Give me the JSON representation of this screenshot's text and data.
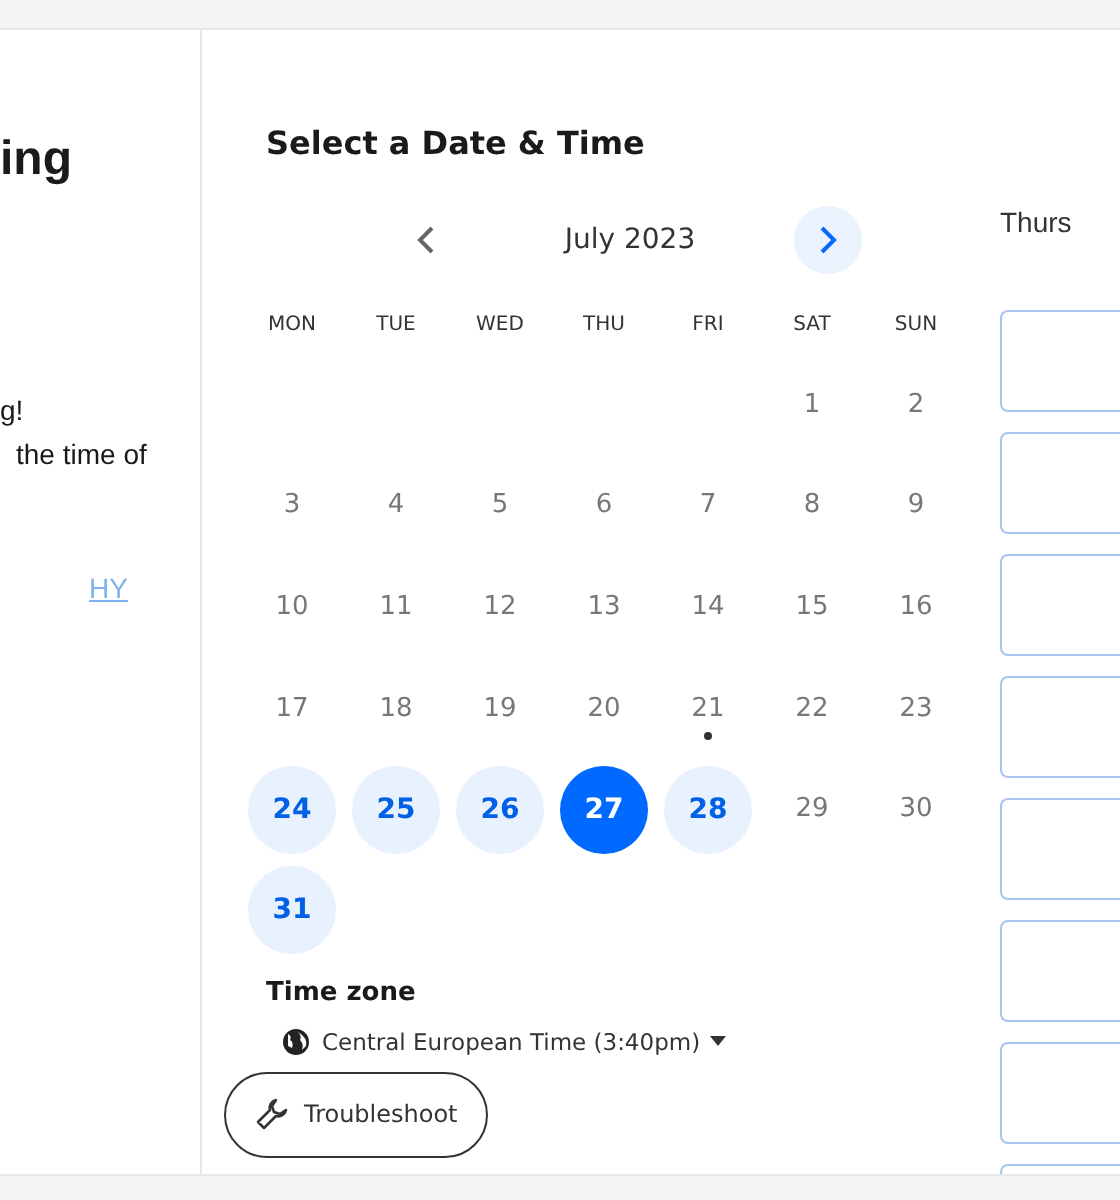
{
  "intro": {
    "title_fragment": "ing",
    "description_lines": [
      "g!",
      "the time of"
    ],
    "link": "HY"
  },
  "calendar": {
    "title": "Select a Date & Time",
    "month": "July 2023",
    "weekdays": [
      "MON",
      "TUE",
      "WED",
      "THU",
      "FRI",
      "SAT",
      "SUN"
    ],
    "days": [
      {
        "kind": "blank"
      },
      {
        "kind": "blank"
      },
      {
        "kind": "blank"
      },
      {
        "kind": "blank"
      },
      {
        "kind": "blank"
      },
      {
        "kind": "day",
        "label": "1",
        "available": false,
        "selected": false,
        "today": false
      },
      {
        "kind": "day",
        "label": "2",
        "available": false,
        "selected": false,
        "today": false
      },
      {
        "kind": "day",
        "label": "3",
        "available": false,
        "selected": false,
        "today": false
      },
      {
        "kind": "day",
        "label": "4",
        "available": false,
        "selected": false,
        "today": false
      },
      {
        "kind": "day",
        "label": "5",
        "available": false,
        "selected": false,
        "today": false
      },
      {
        "kind": "day",
        "label": "6",
        "available": false,
        "selected": false,
        "today": false
      },
      {
        "kind": "day",
        "label": "7",
        "available": false,
        "selected": false,
        "today": false
      },
      {
        "kind": "day",
        "label": "8",
        "available": false,
        "selected": false,
        "today": false
      },
      {
        "kind": "day",
        "label": "9",
        "available": false,
        "selected": false,
        "today": false
      },
      {
        "kind": "day",
        "label": "10",
        "available": false,
        "selected": false,
        "today": false
      },
      {
        "kind": "day",
        "label": "11",
        "available": false,
        "selected": false,
        "today": false
      },
      {
        "kind": "day",
        "label": "12",
        "available": false,
        "selected": false,
        "today": false
      },
      {
        "kind": "day",
        "label": "13",
        "available": false,
        "selected": false,
        "today": false
      },
      {
        "kind": "day",
        "label": "14",
        "available": false,
        "selected": false,
        "today": false
      },
      {
        "kind": "day",
        "label": "15",
        "available": false,
        "selected": false,
        "today": false
      },
      {
        "kind": "day",
        "label": "16",
        "available": false,
        "selected": false,
        "today": false
      },
      {
        "kind": "day",
        "label": "17",
        "available": false,
        "selected": false,
        "today": false
      },
      {
        "kind": "day",
        "label": "18",
        "available": false,
        "selected": false,
        "today": false
      },
      {
        "kind": "day",
        "label": "19",
        "available": false,
        "selected": false,
        "today": false
      },
      {
        "kind": "day",
        "label": "20",
        "available": false,
        "selected": false,
        "today": false
      },
      {
        "kind": "day",
        "label": "21",
        "available": false,
        "selected": false,
        "today": true
      },
      {
        "kind": "day",
        "label": "22",
        "available": false,
        "selected": false,
        "today": false
      },
      {
        "kind": "day",
        "label": "23",
        "available": false,
        "selected": false,
        "today": false
      },
      {
        "kind": "day",
        "label": "24",
        "available": true,
        "selected": false,
        "today": false
      },
      {
        "kind": "day",
        "label": "25",
        "available": true,
        "selected": false,
        "today": false
      },
      {
        "kind": "day",
        "label": "26",
        "available": true,
        "selected": false,
        "today": false
      },
      {
        "kind": "day",
        "label": "27",
        "available": true,
        "selected": true,
        "today": false
      },
      {
        "kind": "day",
        "label": "28",
        "available": true,
        "selected": false,
        "today": false
      },
      {
        "kind": "day",
        "label": "29",
        "available": false,
        "selected": false,
        "today": false
      },
      {
        "kind": "day",
        "label": "30",
        "available": false,
        "selected": false,
        "today": false
      },
      {
        "kind": "day",
        "label": "31",
        "available": true,
        "selected": false,
        "today": false
      }
    ],
    "timezone_label": "Time zone",
    "timezone": "Central European Time (3:40pm)"
  },
  "troubleshoot_button": "Troubleshoot",
  "times": {
    "date_fragment": "Thurs",
    "slots": [
      {
        "kind": "slot"
      },
      {
        "kind": "slot"
      },
      {
        "kind": "slot"
      },
      {
        "kind": "slot"
      },
      {
        "kind": "slot"
      },
      {
        "kind": "slot"
      },
      {
        "kind": "slot"
      },
      {
        "kind": "slot"
      }
    ]
  }
}
